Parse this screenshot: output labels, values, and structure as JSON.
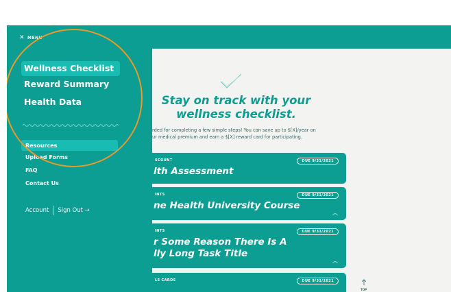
{
  "menu": {
    "close_icon": "close-icon",
    "label": "MENU"
  },
  "nav": [
    {
      "label": "Wellness Checklist",
      "active": true
    },
    {
      "label": "Reward Summary",
      "active": false
    },
    {
      "label": "Health Data",
      "active": false
    }
  ],
  "links": [
    {
      "label": "Resources",
      "active": true
    },
    {
      "label": "Upload Forms",
      "active": false
    },
    {
      "label": "FAQ",
      "active": false
    },
    {
      "label": "Contact Us",
      "active": false
    }
  ],
  "account": {
    "account_label": "Account",
    "signout_label": "Sign Out →"
  },
  "main": {
    "headline_1": "Stay on track with your",
    "headline_2": "wellness checklist.",
    "desc_1": "rded for completing a few simple steps! You can save up to $[X]/year on",
    "desc_2": "ur medical premium and earn a $[X] reward card for participating."
  },
  "cards": [
    {
      "tag": "SCOUNT",
      "due": "DUE 9/31/2021",
      "title_1": "lth Assessment",
      "title_2": ""
    },
    {
      "tag": "INTS",
      "due": "DUE 9/31/2021",
      "title_1": "ne Health University Course",
      "title_2": ""
    },
    {
      "tag": "INTS",
      "due": "DUE 9/31/2021",
      "title_1": "r Some Reason There Is A",
      "title_2": "lly Long Task Title"
    },
    {
      "tag": "LE CARDS",
      "due": "DUE 9/31/2021",
      "title_1": "",
      "title_2": ""
    }
  ],
  "scroll_top": {
    "label": "TOP"
  },
  "colors": {
    "teal": "#0c9d93",
    "highlight": "#19bcb2",
    "annotation": "#e89b2a"
  }
}
